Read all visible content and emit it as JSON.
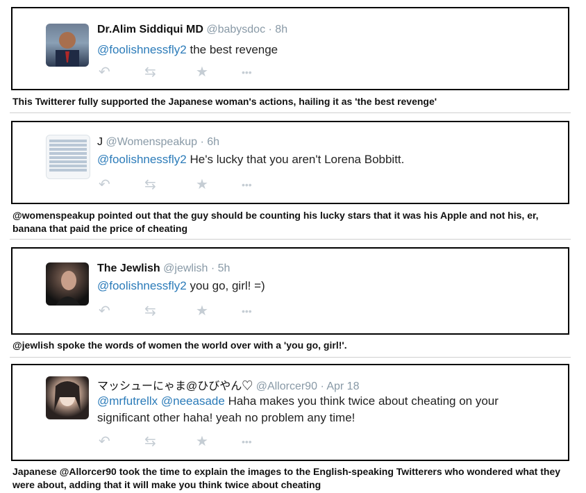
{
  "tweets": [
    {
      "name": "Dr.Alim Siddiqui MD",
      "handle": "@babysdoc",
      "time": "· 8h",
      "mentions": [
        "@foolishnessfly2"
      ],
      "text": " the best revenge",
      "caption": "This Twitterer fully supported the Japanese woman's actions, hailing it as 'the best revenge'"
    },
    {
      "name": "J",
      "handle": "@Womenspeakup",
      "time": "· 6h",
      "mentions": [
        "@foolishnessfly2"
      ],
      "text": " He's lucky that you aren't Lorena Bobbitt.",
      "caption": "@womenspeakup pointed out that the guy should be counting his lucky stars that it was his Apple and not his, er, banana that paid the price of cheating"
    },
    {
      "name": "The Jewlish",
      "handle": "@jewlish",
      "time": "· 5h",
      "mentions": [
        "@foolishnessfly2"
      ],
      "text": " you go, girl! =)",
      "caption": "@jewlish spoke the words of women the world over with a 'you go, girl!'."
    },
    {
      "name": "マッシューにゃま@ひびやん♡",
      "handle": "@Allorcer90",
      "time": "· Apr 18",
      "mentions": [
        "@mrfutrellx",
        "@neeasade"
      ],
      "text": " Haha makes you think twice about cheating on your significant other haha! yeah no problem any time!",
      "caption": "Japanese @Allorcer90 took the time to explain the images to the English-speaking Twitterers who wondered what they were about, adding that it will make you think twice about cheating"
    }
  ],
  "icons": {
    "reply": "↶",
    "retweet": "⇆",
    "favorite": "★",
    "more": "•••"
  }
}
